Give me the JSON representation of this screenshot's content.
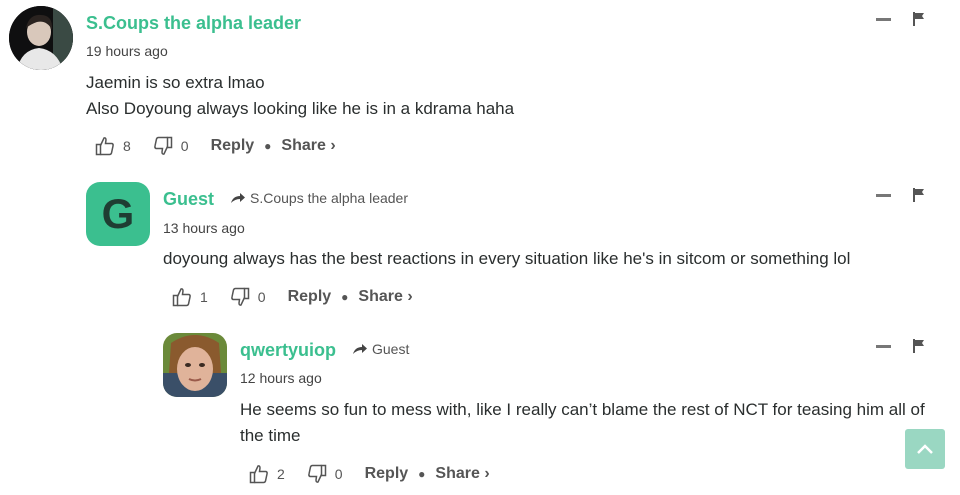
{
  "comments": [
    {
      "author": "S.Coups the alpha leader",
      "time": "19 hours ago",
      "body": [
        "Jaemin is so extra lmao",
        "Also Doyoung always looking like he is in a kdrama haha"
      ],
      "upvotes": "8",
      "downvotes": "0",
      "reply_label": "Reply",
      "share_label": "Share ›"
    },
    {
      "author": "Guest",
      "avatar_letter": "G",
      "replying_to": "S.Coups the alpha leader",
      "time": "13 hours ago",
      "body": [
        "doyoung always has the best reactions in every situation like he's in sitcom or something lol"
      ],
      "upvotes": "1",
      "downvotes": "0",
      "reply_label": "Reply",
      "share_label": "Share ›"
    },
    {
      "author": "qwertyuiop",
      "replying_to": "Guest",
      "time": "12 hours ago",
      "body": [
        "He seems so fun to mess with, like I really can’t blame the rest of NCT for teasing him all of the time"
      ],
      "upvotes": "2",
      "downvotes": "0",
      "reply_label": "Reply",
      "share_label": "Share ›"
    }
  ],
  "colors": {
    "accent": "#3bbf8f",
    "text": "#2a2e2e",
    "muted": "#555555",
    "scroll_button": "#9ad7c2"
  }
}
